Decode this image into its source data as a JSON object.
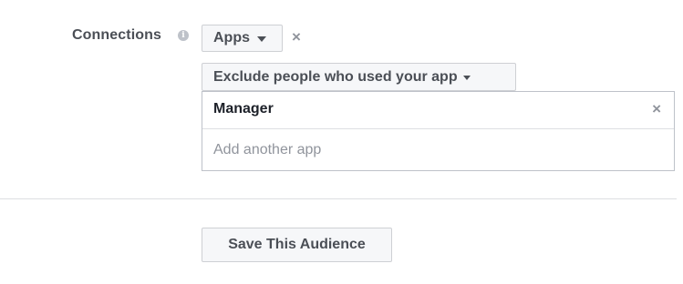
{
  "connections": {
    "label": "Connections",
    "info_icon": "i",
    "type_select": {
      "value": "Apps",
      "remove_glyph": "×"
    },
    "mode_select": {
      "value": "Exclude people who used your app"
    },
    "apps": [
      {
        "name": "Manager",
        "remove_glyph": "×"
      }
    ],
    "add_app_placeholder": "Add another app"
  },
  "footer": {
    "save_label": "Save This Audience"
  }
}
